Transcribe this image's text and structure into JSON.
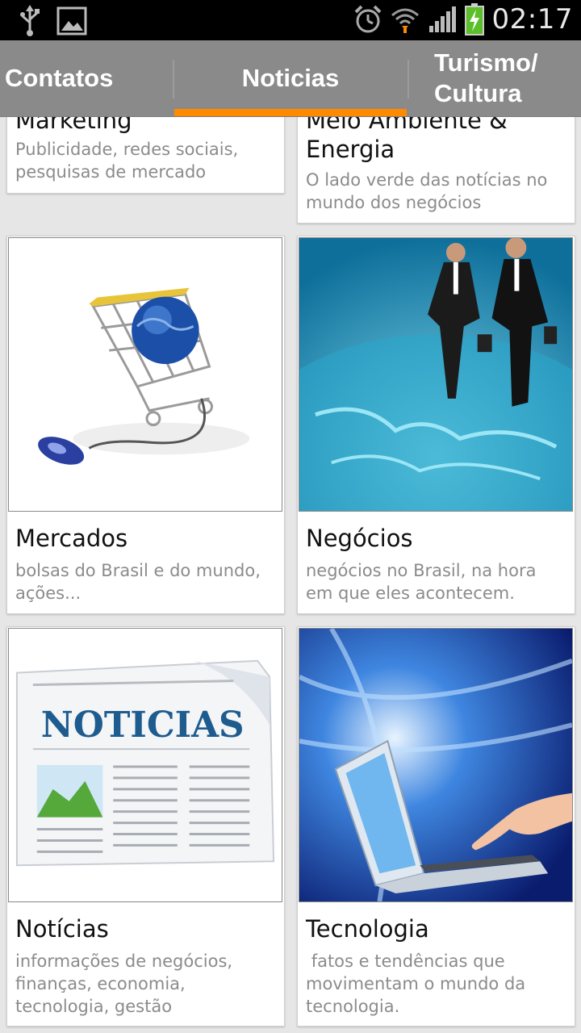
{
  "status_bar": {
    "time": "02:17",
    "icons": [
      "usb-icon",
      "gallery-icon",
      "alarm-icon",
      "wifi-icon",
      "signal-icon",
      "battery-charging-icon"
    ]
  },
  "tabs": [
    {
      "label": "Contatos",
      "selected": false
    },
    {
      "label": "Noticias",
      "selected": true
    },
    {
      "label": "Turismo/ Cultura",
      "line1": "Turismo/",
      "line2": "Cultura",
      "selected": false
    }
  ],
  "colors": {
    "tab_bar": "#8a8a8a",
    "accent": "#ff8a00",
    "background": "#e6e6e6"
  },
  "cards": [
    {
      "title": "Marketing",
      "description": "Publicidade, redes sociais, pesquisas de mercado"
    },
    {
      "title": "Meio Ambiente & Energia",
      "description": "O lado verde das notícias no mundo dos negócios"
    },
    {
      "title": "Mercados",
      "description": "bolsas do Brasil e do mundo, ações..."
    },
    {
      "title": "Negócios",
      "description": "negócios no Brasil, na hora em que eles acontecem."
    },
    {
      "title": "Notícias",
      "description": "informações de negócios, finanças, economia, tecnologia, gestão",
      "image_text": "NOTICIAS"
    },
    {
      "title": "Tecnologia",
      "description": " fatos e tendências que movimentam o mundo da tecnologia."
    }
  ]
}
